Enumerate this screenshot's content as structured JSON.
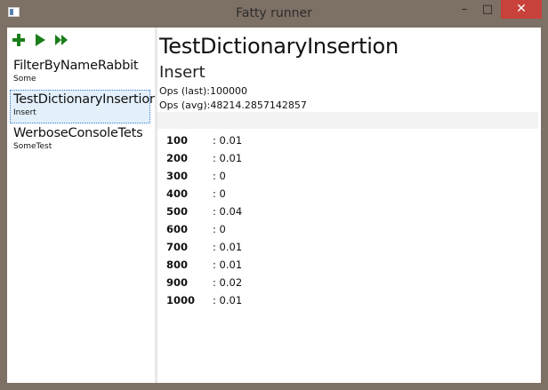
{
  "window": {
    "title": "Fatty runner",
    "controls": {
      "minimize": "–",
      "maximize": "□",
      "close": "✕"
    }
  },
  "toolbar": {
    "icons": [
      "add-icon",
      "play-icon",
      "fast-forward-icon"
    ],
    "accent": "#1a7f1a"
  },
  "tests": [
    {
      "name": "FilterByNameRabbit",
      "subtitle": "Some",
      "selected": false
    },
    {
      "name": "TestDictionaryInsertion",
      "subtitle": "Insert",
      "selected": true
    },
    {
      "name": "WerboseConsoleTets",
      "subtitle": "SomeTest",
      "selected": false
    }
  ],
  "detail": {
    "title": "TestDictionaryInsertion",
    "subtitle": "Insert",
    "ops_last": "Ops (last):100000",
    "ops_avg": "Ops (avg):48214.2857142857",
    "results": [
      {
        "key": "100",
        "value": ": 0.01"
      },
      {
        "key": "200",
        "value": ": 0.01"
      },
      {
        "key": "300",
        "value": ": 0"
      },
      {
        "key": "400",
        "value": ": 0"
      },
      {
        "key": "500",
        "value": ": 0.04"
      },
      {
        "key": "600",
        "value": ": 0"
      },
      {
        "key": "700",
        "value": ": 0.01"
      },
      {
        "key": "800",
        "value": ": 0.01"
      },
      {
        "key": "900",
        "value": ": 0.02"
      },
      {
        "key": "1000",
        "value": ": 0.01"
      }
    ]
  },
  "colors": {
    "frame": "#7d7064",
    "close_button": "#c9413b",
    "selection_bg": "#e3f0fb",
    "selection_border": "#3a7bd5"
  }
}
